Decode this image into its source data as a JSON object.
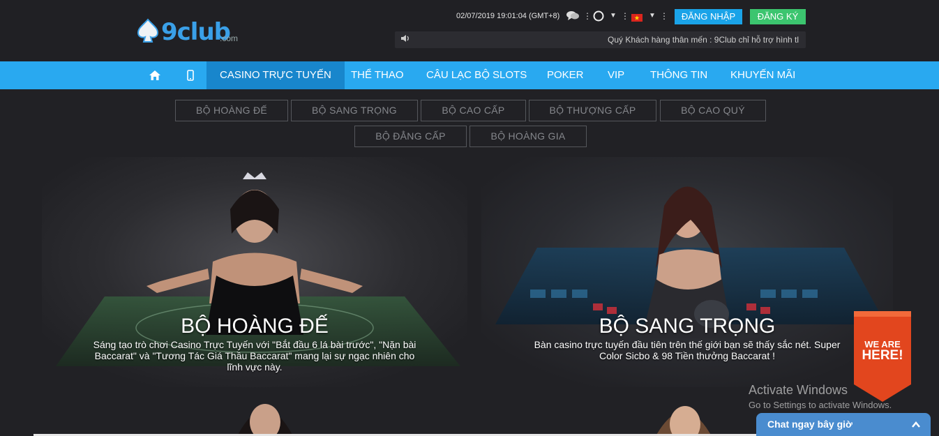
{
  "header": {
    "logo_text": "9club",
    "logo_suffix": ".com",
    "datetime": "02/07/2019 19:01:04 (GMT+8)",
    "icons": [
      "chat-icon",
      "circle-icon",
      "dropdown-icon",
      "flag-vn-icon",
      "dropdown-icon"
    ],
    "login_label": "ĐĂNG NHẬP",
    "register_label": "ĐĂNG KÝ",
    "marquee_text": "Quý Khách hàng thân mến : 9Club chỉ hỗ trợ hình tl",
    "colors": {
      "login": "#1aa3e8",
      "register": "#3cc56f"
    }
  },
  "nav": {
    "items": [
      {
        "label": "",
        "icon": "home-icon"
      },
      {
        "label": "",
        "icon": "mobile-icon"
      },
      {
        "label": "CASINO TRỰC TUYẾN",
        "active": true
      },
      {
        "label": "THỂ THAO"
      },
      {
        "label": "CÂU LẠC BỘ SLOTS"
      },
      {
        "label": "POKER"
      },
      {
        "label": "VIP"
      },
      {
        "label": "THÔNG TIN"
      },
      {
        "label": "KHUYẾN MÃI"
      }
    ],
    "color": "#29a9f0"
  },
  "subtabs": [
    "BỘ HOÀNG ĐẾ",
    "BỘ SANG TRỌNG",
    "BỘ CAO CẤP",
    "BỘ THƯỢNG CẤP",
    "BỘ CAO QUÝ",
    "BỘ ĐẲNG CẤP",
    "BỘ HOÀNG GIA"
  ],
  "panels": [
    {
      "title": "BỘ HOÀNG ĐẾ",
      "description": "Sáng tạo trò chơi Casino Trực Tuyến với \"Bắt đầu 6 lá bài trước\", \"Nặn bài Baccarat\" và \"Tương Tác Giá Thầu Baccarat\" mang lại sự ngạc nhiên cho lĩnh vực này."
    },
    {
      "title": "BỘ SANG TRỌNG",
      "description": "Bàn casino trực tuyến đầu tiên trên thế giới bạn sẽ thấy sắc nét. Super Color Sicbo & 98 Tiền thưởng Baccarat !"
    }
  ],
  "badge": {
    "line1": "WE ARE",
    "line2": "HERE!"
  },
  "activate": {
    "title": "Activate Windows",
    "subtitle": "Go to Settings to activate Windows."
  },
  "chat": {
    "label": "Chat ngay bây giờ"
  }
}
